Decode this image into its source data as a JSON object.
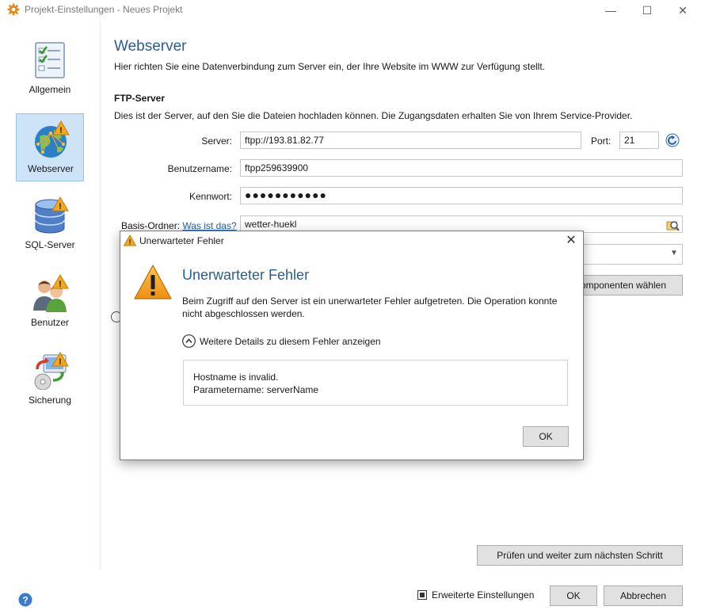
{
  "window": {
    "title": "Projekt-Einstellungen - Neues Projekt",
    "minimize": "—",
    "maximize": "☐",
    "close": "✕"
  },
  "sidebar": {
    "items": [
      {
        "label": "Allgemein"
      },
      {
        "label": "Webserver"
      },
      {
        "label": "SQL-Server"
      },
      {
        "label": "Benutzer"
      },
      {
        "label": "Sicherung"
      }
    ]
  },
  "main": {
    "title": "Webserver",
    "description": "Hier richten Sie eine Datenverbindung zum Server ein, der Ihre Website im WWW zur Verfügung stellt.",
    "section_title": "FTP-Server",
    "section_description": "Dies ist der Server, auf den Sie die Dateien hochladen können. Die Zugangsdaten erhalten Sie von Ihrem Service-Provider.",
    "fields": {
      "server_label": "Server:",
      "server_value": "ftpp://193.81.82.77",
      "port_label": "Port:",
      "port_value": "21",
      "username_label": "Benutzername:",
      "username_value": "ftpp259639900",
      "password_label": "Kennwort:",
      "password_value": "●●●●●●●●●●●",
      "base_folder_label": "Basis-Ordner:",
      "base_folder_link": "Was ist das?",
      "base_folder_value": "wetter-huekl"
    },
    "components_button": "Komponenten wählen",
    "next_button": "Prüfen und weiter zum nächsten Schritt"
  },
  "footer": {
    "advanced_label": "Erweiterte Einstellungen",
    "ok": "OK",
    "cancel": "Abbrechen"
  },
  "dialog": {
    "title": "Unerwarteter Fehler",
    "heading": "Unerwarteter Fehler",
    "message": "Beim Zugriff auf den Server ist ein unerwarteter Fehler aufgetreten. Die Operation konnte nicht abgeschlossen werden.",
    "details_toggle": "Weitere Details zu diesem Fehler anzeigen",
    "details_line1": "Hostname is invalid.",
    "details_line2": "Parametername: serverName",
    "ok": "OK"
  },
  "colors": {
    "accent_title": "#2c5d8f",
    "selection": "#cde3f7",
    "link": "#2a64a8",
    "warning": "#f2a81d"
  }
}
